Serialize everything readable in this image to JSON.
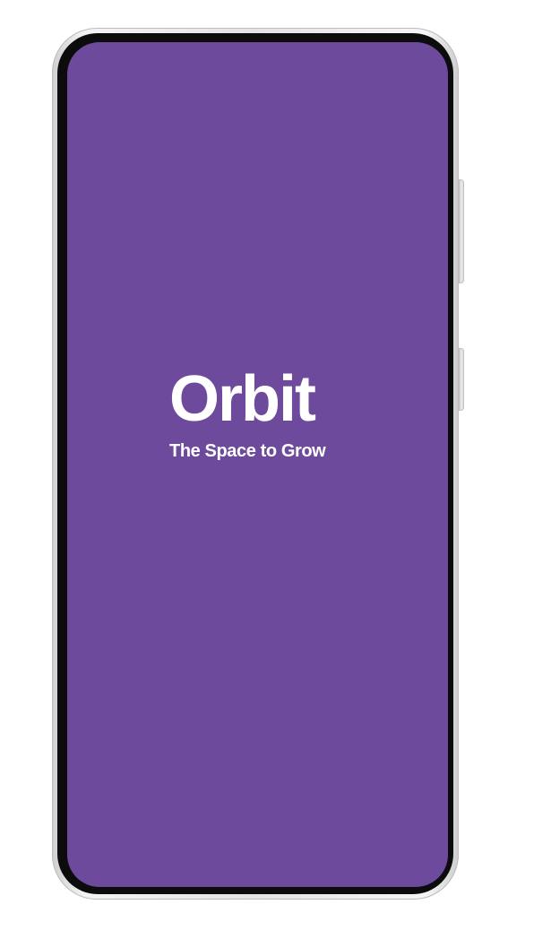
{
  "device": {
    "frame_color": "#e6e6e6",
    "bezel_color": "#0c0c0c"
  },
  "splash": {
    "background_color": "#6e4a9c",
    "text_color": "#ffffff",
    "title": "Orbit",
    "tagline": "The Space to Grow"
  }
}
